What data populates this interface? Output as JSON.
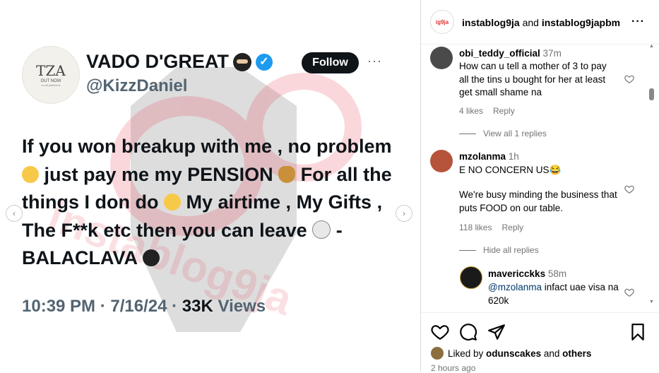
{
  "tweet": {
    "avatar": {
      "logo": "TZA",
      "line1": "OUT NOW",
      "line2": "on all platforms"
    },
    "name": "VADO D'GREAT",
    "handle": "@KizzDaniel",
    "follow_label": "Follow",
    "more_label": "···",
    "text_parts": [
      "If you won breakup with me , no problem",
      "just pay me my PENSION",
      "For all the things I don do",
      "My airtime , My Gifts , The F**k etc then you can leave",
      "- BALACLAVA"
    ],
    "meta": {
      "time": "10:39 PM",
      "sep1": " · ",
      "date": "7/16/24",
      "sep2": " · ",
      "views": "33K",
      "views_label": "Views"
    },
    "watermark": "instablog9ja"
  },
  "carousel": {
    "prev": "‹",
    "next": "›"
  },
  "header": {
    "avatar_text": "ig9ja",
    "account1": "instablog9ja",
    "joiner": " and ",
    "account2": "instablog9japbm",
    "more_label": "···"
  },
  "comments": [
    {
      "username": "obi_teddy_official",
      "time": "37m",
      "text": "How can u tell a mother of 3 to pay all the tins u bought for her at least get small shame na",
      "likes": "4 likes",
      "reply_label": "Reply",
      "replies_toggle": "View all 1 replies"
    },
    {
      "username": "mzolanma",
      "time": "1h",
      "text_line1": "E NO CONCERN US😂",
      "text_line2": "We're busy minding the business that puts FOOD on our table.",
      "likes": "118 likes",
      "reply_label": "Reply",
      "replies_toggle": "Hide all replies"
    },
    {
      "username": "mavericckks",
      "time": "58m",
      "mention": "@mzolanma",
      "text": " infact uae visa na 620k"
    }
  ],
  "footer": {
    "liked_prefix": "Liked by ",
    "liked_user": "odunscakes",
    "liked_suffix": " and ",
    "liked_others": "others",
    "time_ago": "2 hours ago"
  },
  "colors": {
    "accent": "#0095f6",
    "verified": "#1d9bf0",
    "muted": "#737373",
    "watermark_red": "#e8475a"
  }
}
